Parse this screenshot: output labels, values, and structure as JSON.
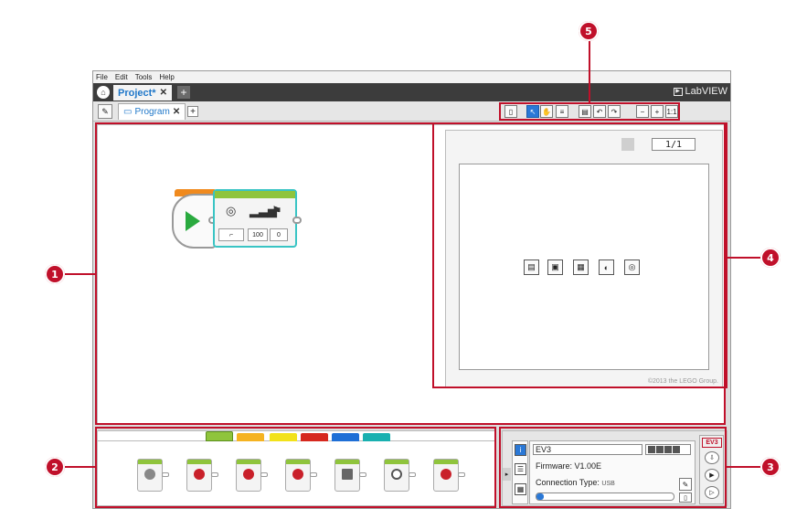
{
  "menu": {
    "items": [
      "File",
      "Edit",
      "Tools",
      "Help"
    ]
  },
  "title_bar": {
    "project_tab": "Project*",
    "close_glyph": "✕",
    "add_glyph": "+",
    "brand": "LabVIEW"
  },
  "toolbar": {
    "program_tab": "Program",
    "close_glyph": "✕",
    "add_glyph": "+"
  },
  "program": {
    "power_value": "100",
    "rotations_value": "0"
  },
  "content_editor": {
    "page_count": "1/1",
    "copyright": "©2013 the LEGO Group."
  },
  "palette_colors": [
    "#8fc43c",
    "#f5b321",
    "#f2e21a",
    "#d6281e",
    "#1e6fd6",
    "#19b0b0"
  ],
  "hardware": {
    "brick_name": "EV3",
    "firmware": "Firmware: V1.00E",
    "connection_label": "Connection Type:",
    "connection_value": "USB",
    "battery_level": 0.8,
    "ev3_tag": "EV3",
    "progress": 0.05
  },
  "callouts": [
    "1",
    "2",
    "3",
    "4",
    "5"
  ],
  "accent_color": "#c0102a"
}
